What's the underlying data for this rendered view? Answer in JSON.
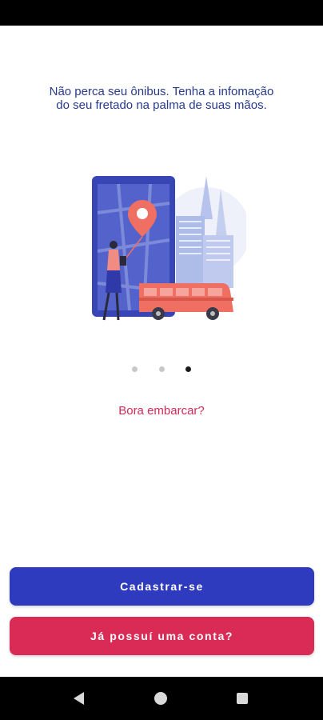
{
  "onboarding": {
    "headline_line1": "Não perca seu ônibus. Tenha a infomação",
    "headline_line2": "do seu fretado na palma de suas mãos.",
    "subtitle": "Bora embarcar?",
    "page_indicator": {
      "total": 3,
      "active": 3
    }
  },
  "actions": {
    "register_label": "Cadastrar-se",
    "login_label": "Já possuí uma conta?"
  },
  "colors": {
    "headline": "#283a8a",
    "accent_pink": "#d92b55",
    "primary_blue": "#2f3bbf"
  },
  "illustration": {
    "icons": [
      "phone-map-icon",
      "location-pin-icon",
      "woman-icon",
      "bus-icon",
      "buildings-icon"
    ]
  },
  "navigation": {
    "icons": [
      "back-icon",
      "home-icon",
      "recents-icon"
    ]
  }
}
